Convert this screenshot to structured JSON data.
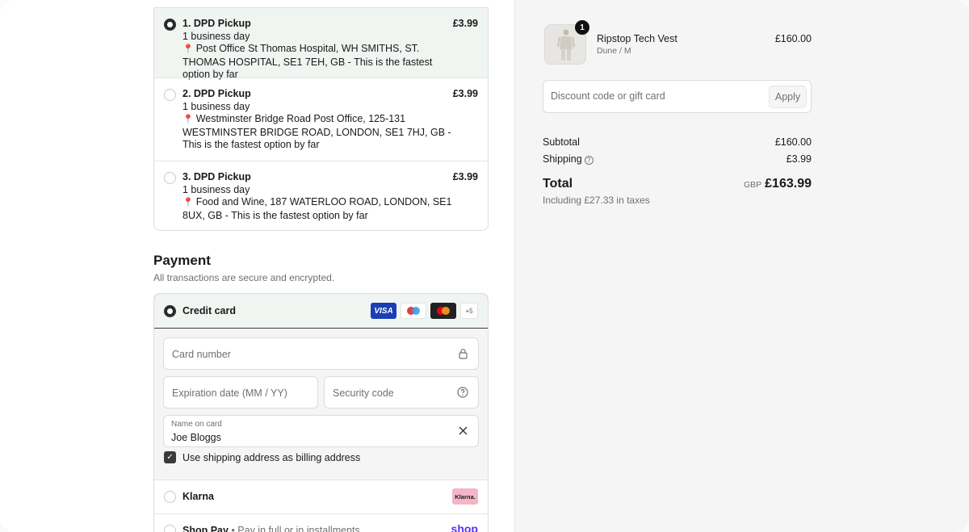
{
  "shipping_options": [
    {
      "title": "1. DPD Pickup",
      "price": "£3.99",
      "eta": "1 business day",
      "address": "Post Office St Thomas Hospital, WH SMITHS, ST. THOMAS HOSPITAL, SE1 7EH, GB - This is the fastest option by far",
      "selected": true
    },
    {
      "title": "2. DPD Pickup",
      "price": "£3.99",
      "eta": "1 business day",
      "address": "Westminster Bridge Road Post Office, 125-131 WESTMINSTER BRIDGE ROAD, LONDON, SE1 7HJ, GB - This is the fastest option by far",
      "selected": false
    },
    {
      "title": "3. DPD Pickup",
      "price": "£3.99",
      "eta": "1 business day",
      "address": "Food and Wine, 187 WATERLOO ROAD, LONDON, SE1 8UX, GB - This is the fastest option by far",
      "selected": false
    }
  ],
  "payment": {
    "title": "Payment",
    "subtitle": "All transactions are secure and encrypted.",
    "credit_card": {
      "label": "Credit card",
      "brands": [
        "VISA",
        "maestro",
        "mastercard"
      ],
      "more_brands": "+5",
      "card_number_placeholder": "Card number",
      "expiry_placeholder": "Expiration date (MM / YY)",
      "security_placeholder": "Security code",
      "name_label": "Name on card",
      "name_value": "Joe Bloggs",
      "billing_same_label": "Use shipping address as billing address",
      "billing_same_checked": true
    },
    "klarna": {
      "label": "Klarna",
      "badge": "Klarna."
    },
    "shop_pay": {
      "label": "Shop Pay",
      "sublabel": " • Pay in full or in installments",
      "logo": "shop"
    }
  },
  "order": {
    "item": {
      "name": "Ripstop Tech Vest",
      "variant": "Dune / M",
      "price": "£160.00",
      "quantity": "1"
    },
    "discount": {
      "placeholder": "Discount code or gift card",
      "apply_label": "Apply"
    },
    "subtotal_label": "Subtotal",
    "subtotal": "£160.00",
    "shipping_label": "Shipping",
    "shipping": "£3.99",
    "total_label": "Total",
    "currency": "GBP",
    "total": "£163.99",
    "taxes_note": "Including £27.33 in taxes"
  },
  "icons": {
    "pin": "map-pin-icon",
    "lock": "lock-icon",
    "help": "help-circle-icon",
    "clear": "close-icon",
    "check": "checkmark-icon"
  },
  "colors": {
    "accent_bg": "#f0f5f1",
    "selected_border": "#3d3d3d",
    "visa": "#1a3fb5",
    "klarna": "#f4b6c7",
    "shop_pay": "#5a31f4"
  }
}
